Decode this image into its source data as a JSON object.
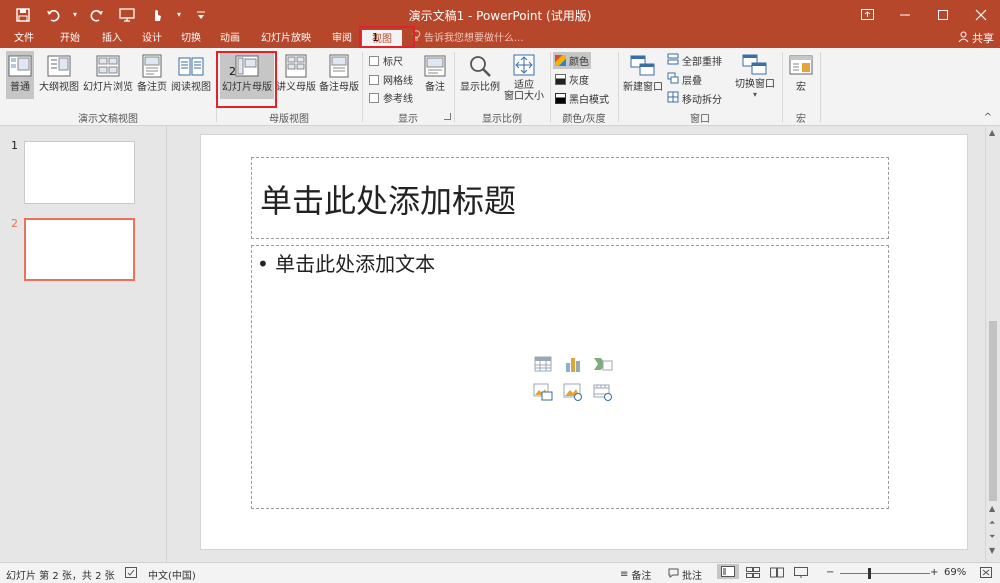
{
  "window": {
    "title": "演示文稿1 - PowerPoint (试用版)"
  },
  "tabs": [
    {
      "label": "文件"
    },
    {
      "label": "开始"
    },
    {
      "label": "插入"
    },
    {
      "label": "设计"
    },
    {
      "label": "切换"
    },
    {
      "label": "动画"
    },
    {
      "label": "幻灯片放映"
    },
    {
      "label": "审阅"
    },
    {
      "label": "视图"
    }
  ],
  "active_tab": "视图",
  "tell_me": "告诉我您想要做什么...",
  "share": "共享",
  "markers": {
    "one": "1",
    "two": "2"
  },
  "ribbon": {
    "presentation_views": {
      "label": "演示文稿视图",
      "buttons": [
        "普通",
        "大纲视图",
        "幻灯片浏览",
        "备注页",
        "阅读视图"
      ]
    },
    "master_views": {
      "label": "母版视图",
      "buttons": [
        "幻灯片母版",
        "讲义母版",
        "备注母版"
      ]
    },
    "show": {
      "label": "显示",
      "checkboxes": [
        "标尺",
        "网格线",
        "参考线"
      ],
      "notes_button": "备注"
    },
    "zoom": {
      "label": "显示比例",
      "zoom_button": "显示比例",
      "fit_line1": "适应",
      "fit_line2": "窗口大小"
    },
    "color": {
      "label": "颜色/灰度",
      "options": [
        "颜色",
        "灰度",
        "黑白模式"
      ]
    },
    "window": {
      "label": "窗口",
      "new_window": "新建窗口",
      "arrange_all": "全部重排",
      "cascade": "层叠",
      "move_split": "移动拆分",
      "switch_windows": "切换窗口"
    },
    "macros": {
      "label": "宏",
      "button": "宏"
    }
  },
  "thumbnails": [
    {
      "number": "1"
    },
    {
      "number": "2"
    }
  ],
  "slide": {
    "title_placeholder": "单击此处添加标题",
    "body_placeholder": "• 单击此处添加文本"
  },
  "status": {
    "slide_info": "幻灯片 第 2 张，共 2 张",
    "language": "中文(中国)",
    "notes": "备注",
    "comments": "批注",
    "zoom_level": "69%"
  },
  "colors": {
    "brand": "#b7472a",
    "highlight_box": "#e0232b",
    "active_thumb": "#e7745a"
  }
}
